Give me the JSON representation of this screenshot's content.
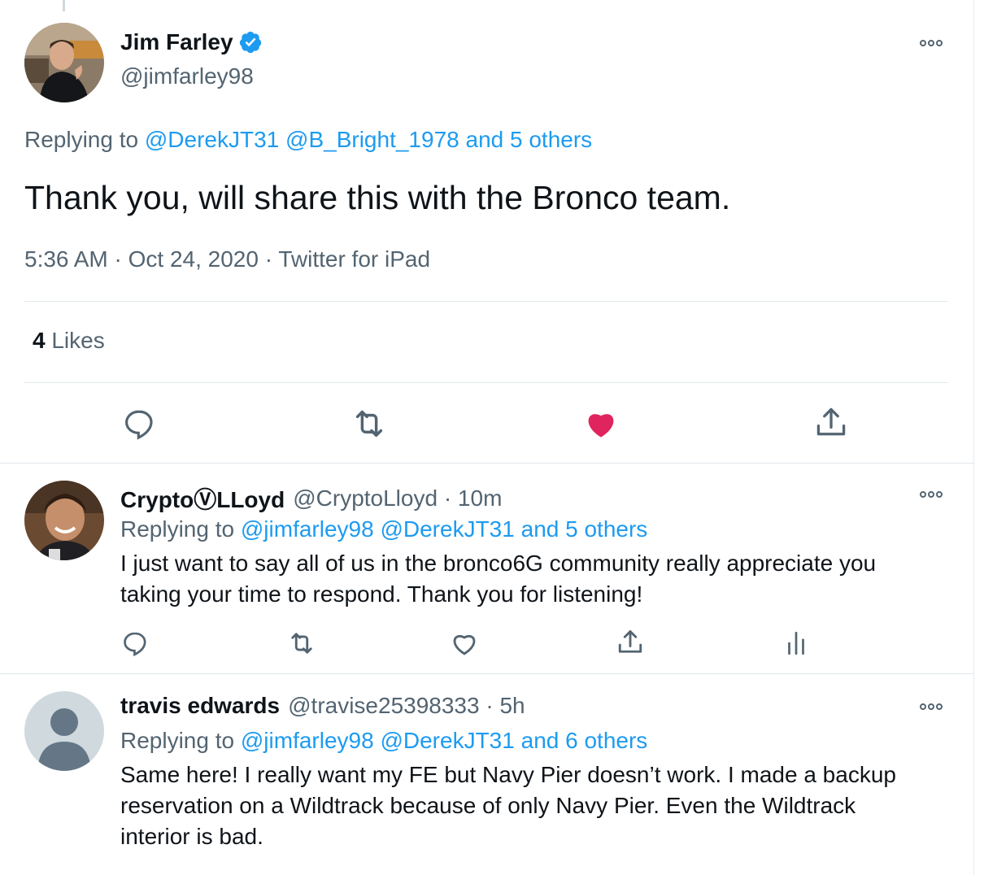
{
  "main_tweet": {
    "author_name": "Jim Farley",
    "author_handle": "@jimfarley98",
    "replying_prefix": "Replying to",
    "replying_to": [
      "@DerekJT31",
      "@B_Bright_1978",
      "and 5 others"
    ],
    "text": "Thank you, will share this with the Bronco team.",
    "timestamp": "5:36 AM · Oct 24, 2020 · Twitter for iPad",
    "likes_count": "4",
    "likes_label": "Likes",
    "liked": true
  },
  "replies": [
    {
      "author_name": "CryptoⓋLLoyd",
      "author_handle": "@CryptoLloyd · 10m",
      "replying_prefix": "Replying to",
      "replying_to": [
        "@jimfarley98",
        "@DerekJT31",
        "and 5 others"
      ],
      "text": "I just want to say all of us in the bronco6G community really appreciate you taking your time to respond. Thank you for listening!"
    },
    {
      "author_name": "travis edwards",
      "author_handle": "@travise25398333 · 5h",
      "replying_prefix": "Replying to",
      "replying_to": [
        "@jimfarley98",
        "@DerekJT31",
        "and 6 others"
      ],
      "text": "Same here! I really want my FE but Navy Pier doesn’t work. I made a backup reservation on a Wildtrack because of only Navy Pier.  Even the Wildtrack interior is bad."
    }
  ],
  "colors": {
    "accent": "#1d9bf0",
    "like_red": "#e0245e",
    "secondary_text": "#536471",
    "divider": "#e1e8ed"
  },
  "icons": [
    "verified-badge-icon",
    "more-options-icon",
    "reply-icon",
    "retweet-icon",
    "like-heart-icon",
    "share-icon",
    "analytics-icon",
    "default-avatar-icon"
  ]
}
